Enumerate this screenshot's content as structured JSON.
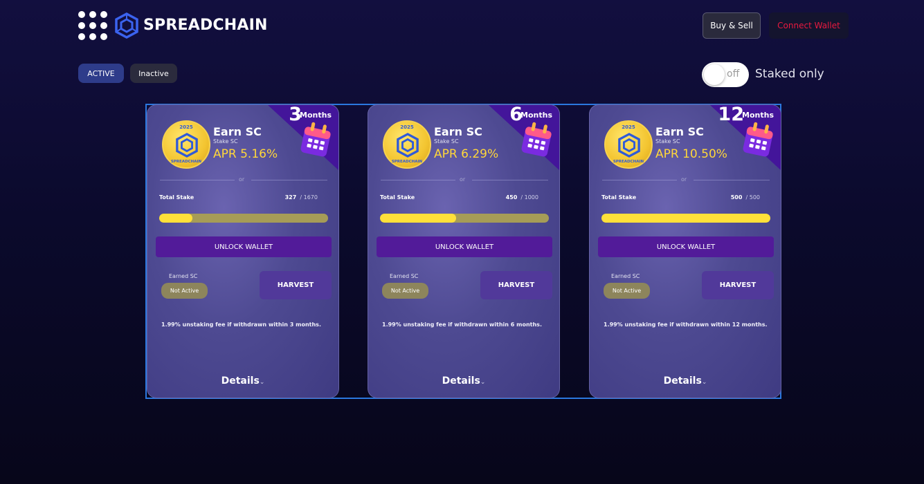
{
  "header": {
    "brand": "SPREADCHAIN",
    "buy_sell_label": "Buy & Sell",
    "connect_wallet_label": "Connect Wallet"
  },
  "filters": {
    "active_label": "ACTIVE",
    "inactive_label": "Inactive",
    "toggle_state": "off",
    "staked_only_label": "Staked only"
  },
  "colors": {
    "accent_yellow": "#ffd73a",
    "unlock_purple": "#521b99",
    "connect_red": "#e8193f",
    "frame_blue": "#2b78e0"
  },
  "cards": [
    {
      "months_num": "3",
      "months_word": "Months",
      "coin_year": "2025",
      "coin_name": "SPREADCHAIN",
      "title": "Earn SC",
      "subtitle": "Stake SC",
      "apr": "APR 5.16%",
      "or": "or",
      "total_stake_label": "Total Stake",
      "stake_value": "327",
      "stake_max": "/ 1670",
      "progress": 0.196,
      "unlock_label": "UNLOCK WALLET",
      "earned_label": "Earned SC",
      "status": "Not Active",
      "harvest_label": "HARVEST",
      "fee_text": "1.99% unstaking fee if withdrawn within 3 months.",
      "details_label": "Details"
    },
    {
      "months_num": "6",
      "months_word": "Months",
      "coin_year": "2025",
      "coin_name": "SPREADCHAIN",
      "title": "Earn SC",
      "subtitle": "Stake SC",
      "apr": "APR 6.29%",
      "or": "or",
      "total_stake_label": "Total Stake",
      "stake_value": "450",
      "stake_max": "/ 1000",
      "progress": 0.45,
      "unlock_label": "UNLOCK WALLET",
      "earned_label": "Earned SC",
      "status": "Not Active",
      "harvest_label": "HARVEST",
      "fee_text": "1.99% unstaking fee if withdrawn within 6 months.",
      "details_label": "Details"
    },
    {
      "months_num": "12",
      "months_word": "Months",
      "coin_year": "2025",
      "coin_name": "SPREADCHAIN",
      "title": "Earn SC",
      "subtitle": "Stake SC",
      "apr": "APR 10.50%",
      "or": "or",
      "total_stake_label": "Total Stake",
      "stake_value": "500",
      "stake_max": "/ 500",
      "progress": 1.0,
      "unlock_label": "UNLOCK WALLET",
      "earned_label": "Earned SC",
      "status": "Not Active",
      "harvest_label": "HARVEST",
      "fee_text": "1.99% unstaking fee if withdrawn within 12 months.",
      "details_label": "Details"
    }
  ]
}
